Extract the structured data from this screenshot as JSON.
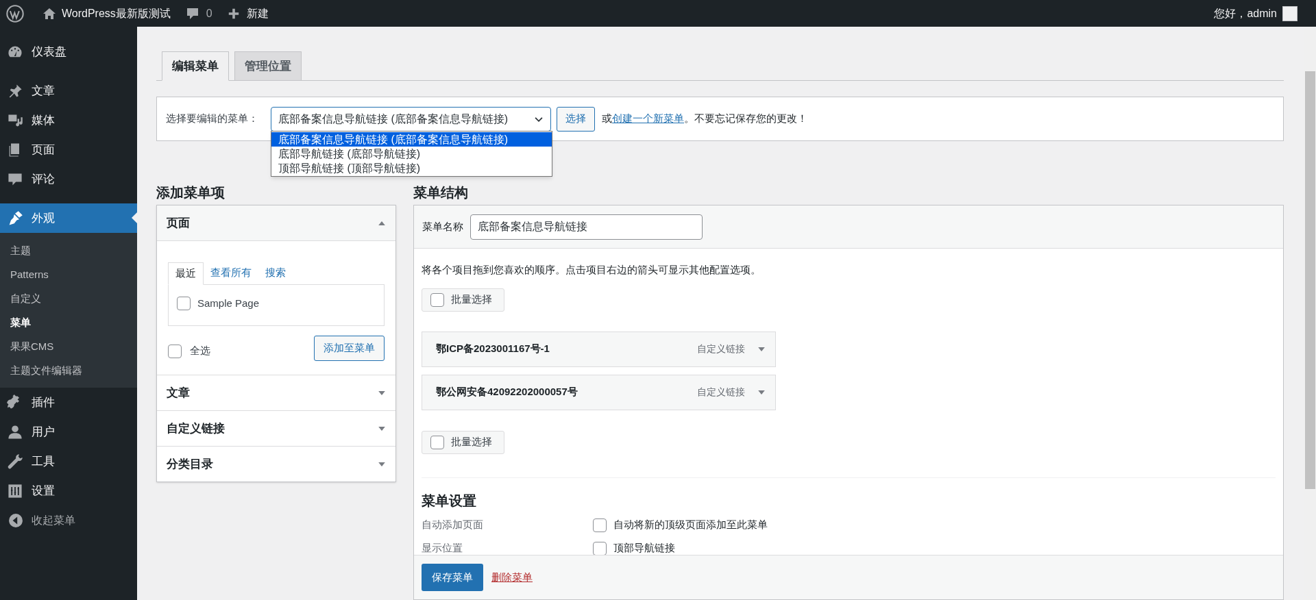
{
  "admin_bar": {
    "site_title": "WordPress最新版测试",
    "comments_count": "0",
    "new_label": "新建",
    "greeting": "您好，admin"
  },
  "sidebar": {
    "items": [
      {
        "label": "仪表盘",
        "selected": false
      },
      {
        "label": "文章",
        "selected": false
      },
      {
        "label": "媒体",
        "selected": false
      },
      {
        "label": "页面",
        "selected": false
      },
      {
        "label": "评论",
        "selected": false
      },
      {
        "label": "外观",
        "selected": true,
        "children": [
          {
            "label": "主题",
            "selected": false
          },
          {
            "label": "Patterns",
            "selected": false
          },
          {
            "label": "自定义",
            "selected": false
          },
          {
            "label": "菜单",
            "selected": true
          },
          {
            "label": "果果CMS",
            "selected": false
          },
          {
            "label": "主题文件编辑器",
            "selected": false
          }
        ]
      },
      {
        "label": "插件",
        "selected": false
      },
      {
        "label": "用户",
        "selected": false
      },
      {
        "label": "工具",
        "selected": false
      },
      {
        "label": "设置",
        "selected": false
      }
    ],
    "collapse_label": "收起菜单"
  },
  "tabs": [
    {
      "label": "编辑菜单",
      "selected": true
    },
    {
      "label": "管理位置",
      "selected": false
    }
  ],
  "menu_select": {
    "label": "选择要编辑的菜单：",
    "value": "底部备案信息导航链接 (底部备案信息导航链接)",
    "expanded": true,
    "options": [
      {
        "label": "底部备案信息导航链接 (底部备案信息导航链接)",
        "selected": true
      },
      {
        "label": "底部导航链接 (底部导航链接)",
        "selected": false
      },
      {
        "label": "顶部导航链接 (顶部导航链接)",
        "selected": false
      }
    ],
    "button": "选择",
    "note_prefix": "或",
    "note_link": "创建一个新菜单",
    "note_suffix": "。不要忘记保存您的更改！"
  },
  "add_items": {
    "title": "添加菜单项",
    "sections": [
      {
        "title": "页面",
        "expanded": true,
        "tabs": [
          {
            "label": "最近",
            "selected": true
          },
          {
            "label": "查看所有",
            "selected": false
          },
          {
            "label": "搜索",
            "selected": false
          }
        ],
        "items": [
          {
            "label": "Sample Page",
            "checked": false
          }
        ],
        "select_all": {
          "label": "全选",
          "checked": false
        },
        "add_button": "添加至菜单"
      },
      {
        "title": "文章",
        "expanded": false
      },
      {
        "title": "自定义链接",
        "expanded": false
      },
      {
        "title": "分类目录",
        "expanded": false
      }
    ]
  },
  "menu_structure": {
    "title": "菜单结构",
    "name_label": "菜单名称",
    "name_value": "底部备案信息导航链接",
    "instructions": "将各个项目拖到您喜欢的顺序。点击项目右边的箭头可显示其他配置选项。",
    "bulk_select": [
      {
        "label": "批量选择",
        "checked": false
      },
      {
        "label": "批量选择",
        "checked": false
      }
    ],
    "items": [
      {
        "title": "鄂ICP备2023001167号-1",
        "type": "自定义链接"
      },
      {
        "title": "鄂公网安备42092202000057号",
        "type": "自定义链接"
      }
    ],
    "settings": {
      "title": "菜单设置",
      "rows": [
        {
          "label": "自动添加页面",
          "options": [
            {
              "label": "自动将新的顶级页面添加至此菜单",
              "checked": false
            }
          ]
        },
        {
          "label": "显示位置",
          "options": [
            {
              "label": "顶部导航链接",
              "checked": false
            }
          ]
        }
      ]
    },
    "save_button": "保存菜单",
    "delete_link": "删除菜单"
  }
}
